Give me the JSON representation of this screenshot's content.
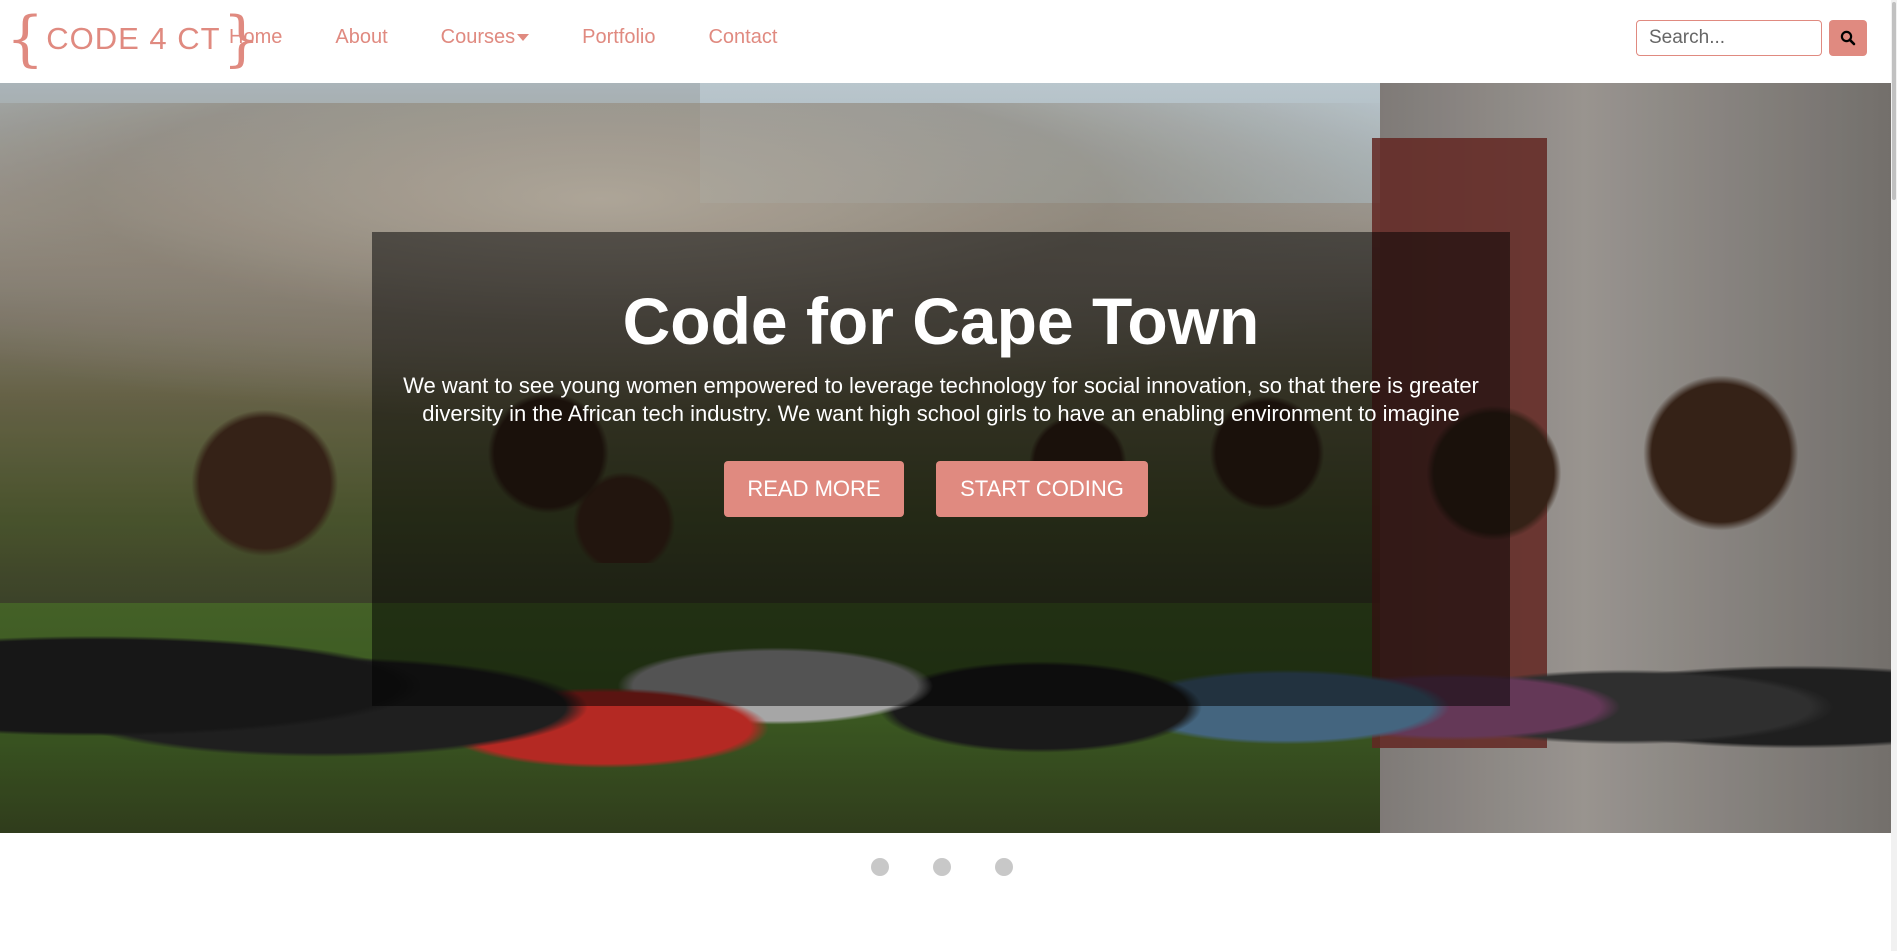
{
  "navbar": {
    "logo_left_brace": "{",
    "logo_text": "CODE 4 CT",
    "logo_right_brace": "}",
    "links": [
      {
        "label": "Home"
      },
      {
        "label": "About"
      },
      {
        "label": "Courses",
        "has_dropdown": true
      },
      {
        "label": "Portfolio"
      },
      {
        "label": "Contact"
      }
    ],
    "search": {
      "placeholder": "Search...",
      "value": ""
    },
    "search_icon": "search-icon"
  },
  "hero": {
    "title": "Code for Cape Town",
    "text": "We want to see young women empowered to leverage technology for social innovation, so that there is greater diversity in the African tech industry. We want high school girls to have an enabling environment to imagine",
    "read_more_label": "READ MORE",
    "start_coding_label": "START CODING"
  },
  "carousel": {
    "slide_count": 3,
    "active_index": 0
  },
  "colors": {
    "accent": "#e08a80",
    "caption_bg": "rgba(0,0,0,0.5)",
    "dot": "#c8c8c8"
  }
}
